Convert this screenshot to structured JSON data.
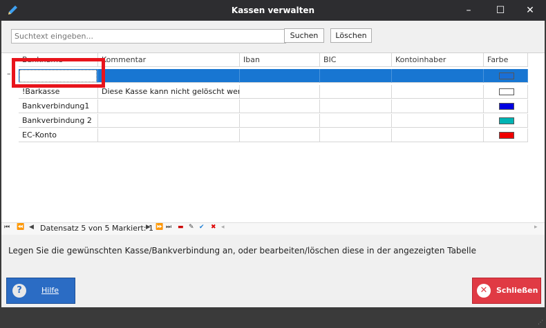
{
  "window": {
    "title": "Kassen verwalten",
    "minimize": "–",
    "maximize": "☐",
    "close": "✕"
  },
  "search": {
    "placeholder": "Suchtext eingeben...",
    "search_label": "Suchen",
    "clear_label": "Löschen"
  },
  "grid": {
    "columns": [
      "Bankname",
      "Kommentar",
      "Iban",
      "BIC",
      "Kontoinhaber",
      "Farbe"
    ],
    "rows": [
      {
        "name": "",
        "comment": "",
        "iban": "",
        "bic": "",
        "owner": "",
        "color": "#1a6fd6"
      },
      {
        "name": "!Barkasse",
        "comment": "Diese Kasse kann nicht gelöscht werden",
        "iban": "",
        "bic": "",
        "owner": "",
        "color": "#ffffff"
      },
      {
        "name": "Bankverbindung1",
        "comment": "",
        "iban": "",
        "bic": "",
        "owner": "",
        "color": "#0000e0"
      },
      {
        "name": "Bankverbindung 2",
        "comment": "",
        "iban": "",
        "bic": "",
        "owner": "",
        "color": "#00b4b4"
      },
      {
        "name": "EC-Konto",
        "comment": "",
        "iban": "",
        "bic": "",
        "owner": "",
        "color": "#f00000"
      }
    ]
  },
  "navigator": {
    "text": "Datensatz 5 von 5 Markiert: 1"
  },
  "hint": "Legen Sie die gewünschten Kasse/Bankverbindung an, oder bearbeiten/löschen diese in der angezeigten Tabelle",
  "buttons": {
    "help": "Hilfe",
    "close": "Schließen"
  },
  "icons": {
    "app": "pencil-icon",
    "help": "question-icon",
    "close": "x-circle-icon"
  }
}
